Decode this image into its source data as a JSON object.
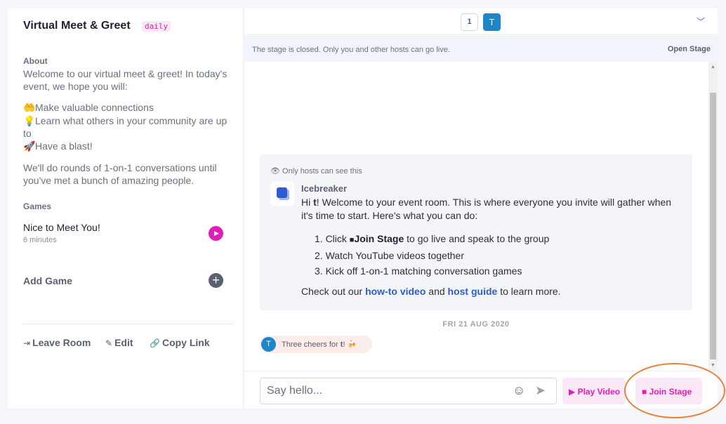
{
  "room": {
    "title": "Virtual Meet & Greet",
    "tag": "daily",
    "about_heading": "About",
    "about_intro": "Welcome to our virtual meet & greet! In today's event, we hope you will:",
    "bullets": [
      {
        "icon": "heart-hands-icon",
        "glyph": "🤲",
        "text": "Make valuable connections"
      },
      {
        "icon": "lightbulb-icon",
        "glyph": "💡",
        "text": "Learn what others in your community are up to"
      },
      {
        "icon": "rocket-icon",
        "glyph": "🚀",
        "text": "Have a blast!"
      }
    ],
    "about_outro": "We'll do rounds of 1-on-1 conversations until you've met a bunch of amazing people.",
    "games_heading": "Games",
    "game": {
      "name": "Nice to Meet You!",
      "duration": "6 minutes"
    },
    "add_game": "Add Game",
    "footer": {
      "leave": "Leave Room",
      "edit": "Edit",
      "copy": "Copy Link"
    }
  },
  "topbar": {
    "count": "1",
    "avatar_initial": "T"
  },
  "stage": {
    "message": "The stage is closed. Only you and other hosts can go live.",
    "open_label": "Open Stage"
  },
  "host_message": {
    "visibility_note": "Only hosts can see this",
    "sender": "Icebreaker",
    "greeting_pre": "Hi ",
    "greeting_name": "t",
    "greeting_post": "! Welcome to your event room. This is where everyone you invite will gather when it's time to start. Here's what you can do:",
    "step1_pre": "1. Click ",
    "step1_bold": "Join Stage",
    "step1_post": " to go live and speak to the group",
    "step2": "2. Watch YouTube videos together",
    "step3": "3. Kick off 1-on-1 matching conversation games",
    "learn_pre": "Check out our ",
    "link1": "how-to video",
    "learn_mid": " and ",
    "link2": "host guide",
    "learn_post": " to learn more."
  },
  "chat": {
    "date": "FRI 21 AUG 2020",
    "cheer_avatar": "T",
    "cheer_pre": "Three cheers for ",
    "cheer_name": "t",
    "cheer_post": "!",
    "cheer_emoji": "🍻"
  },
  "composer": {
    "placeholder": "Say hello...",
    "play_video": "Play Video",
    "join_stage": "Join Stage"
  },
  "colors": {
    "accent": "#e01eb8",
    "link": "#2f5bd1",
    "highlight": "#e8823a"
  }
}
